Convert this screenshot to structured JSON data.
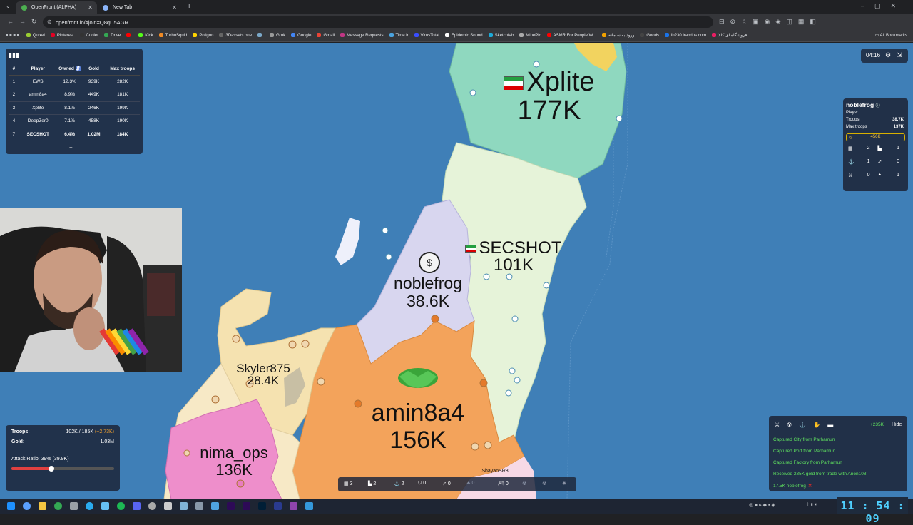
{
  "browser": {
    "tabs": [
      {
        "title": "OpenFront (ALPHA)",
        "active": true
      },
      {
        "title": "New Tab",
        "active": false
      }
    ],
    "url": "openfront.io/#join=Q8qU5AGR",
    "bookmarks": [
      {
        "label": "Quixel",
        "color": "#9acd32"
      },
      {
        "label": "Pinterest",
        "color": "#e60023"
      },
      {
        "label": "Cooler",
        "color": "#333333"
      },
      {
        "label": "Drive",
        "color": "#34a853"
      },
      {
        "label": "",
        "color": "#ff0000"
      },
      {
        "label": "Kick",
        "color": "#53fc18"
      },
      {
        "label": "TurboSquid",
        "color": "#f08a24"
      },
      {
        "label": "Poligon",
        "color": "#ffd400"
      },
      {
        "label": "3Dassets.one",
        "color": "#666666"
      },
      {
        "label": "",
        "color": "#7aa7c7"
      },
      {
        "label": "Grok",
        "color": "#999999"
      },
      {
        "label": "Google",
        "color": "#4285f4"
      },
      {
        "label": "Gmail",
        "color": "#ea4335"
      },
      {
        "label": "Message Requests",
        "color": "#c13584"
      },
      {
        "label": "Time.ir",
        "color": "#4aa3df"
      },
      {
        "label": "VirusTotal",
        "color": "#394eff"
      },
      {
        "label": "Epidemic Sound",
        "color": "#ffffff"
      },
      {
        "label": "Sketchfab",
        "color": "#1caad9"
      },
      {
        "label": "MinePic",
        "color": "#aaaaaa"
      },
      {
        "label": "ASMR For People W...",
        "color": "#ff0000"
      },
      {
        "label": "ورود به سامانه",
        "color": "#f0a000"
      },
      {
        "label": "Goods",
        "color": "#444444"
      },
      {
        "label": "ih230.irandns.com",
        "color": "#1a73e8"
      },
      {
        "label": "فروشگاه ای کالا",
        "color": "#e91e63"
      }
    ],
    "all_bookmarks": "All Bookmarks"
  },
  "leaderboard": {
    "headers": [
      "#",
      "Player",
      "Owned",
      "Gold",
      "Max troops"
    ],
    "rows": [
      {
        "rank": "1",
        "player": "EWS",
        "owned": "12.3%",
        "gold": "939K",
        "max_troops": "282K"
      },
      {
        "rank": "2",
        "player": "amin8a4",
        "owned": "8.9%",
        "gold": "449K",
        "max_troops": "181K"
      },
      {
        "rank": "3",
        "player": "Xplite",
        "owned": "8.1%",
        "gold": "246K",
        "max_troops": "199K"
      },
      {
        "rank": "4",
        "player": "DeepZer0",
        "owned": "7.1%",
        "gold": "458K",
        "max_troops": "190K"
      },
      {
        "rank": "7",
        "player": "SECSHOT",
        "owned": "6.4%",
        "gold": "1.02M",
        "max_troops": "184K"
      }
    ],
    "more": "+"
  },
  "timer": "04:16",
  "player_panel": {
    "name": "noblefrog",
    "type": "Player",
    "troops_label": "Troops",
    "troops": "38.7K",
    "max_troops_label": "Max troops",
    "max_troops": "137K",
    "gold": "456K",
    "buildings": [
      {
        "icon": "city-icon",
        "glyph": "▦",
        "count": "2"
      },
      {
        "icon": "factory-icon",
        "glyph": "▙",
        "count": "1"
      },
      {
        "icon": "port-icon",
        "glyph": "⚓",
        "count": "1"
      },
      {
        "icon": "missile-silo-icon",
        "glyph": "➶",
        "count": "0"
      },
      {
        "icon": "defense-post-icon",
        "glyph": "⚔",
        "count": "0"
      },
      {
        "icon": "sam-launcher-icon",
        "glyph": "⏶",
        "count": "1"
      }
    ]
  },
  "map_labels": [
    {
      "name": "Xplite",
      "troops": "177K",
      "flag": "iran"
    },
    {
      "name": "SECSHOT",
      "troops": "101K",
      "flag": "iran"
    },
    {
      "name": "noblefrog",
      "troops": "38.6K",
      "flag": ""
    },
    {
      "name": "Skyler875",
      "troops": "28.4K",
      "flag": ""
    },
    {
      "name": "amin8a4",
      "troops": "156K",
      "flag": ""
    },
    {
      "name": "nima_ops",
      "troops": "136K",
      "flag": ""
    },
    {
      "name": "ShayanSR8",
      "troops": "",
      "flag": ""
    }
  ],
  "troops_panel": {
    "troops_label": "Troops:",
    "troops_value": "102K / 185K",
    "troops_gain": "(+2.73K)",
    "gold_label": "Gold:",
    "gold_value": "1.03M",
    "attack_ratio_text": "Attack Ratio: 39% (39.9K)",
    "attack_ratio": 0.39
  },
  "action_bar": [
    {
      "icon": "city-icon",
      "glyph": "▦",
      "count": "3",
      "dim": false
    },
    {
      "icon": "factory-icon",
      "glyph": "▙",
      "count": "2",
      "dim": false
    },
    {
      "icon": "port-icon",
      "glyph": "⚓",
      "count": "2",
      "dim": false
    },
    {
      "icon": "defense-icon",
      "glyph": "⛉",
      "count": "0",
      "dim": false
    },
    {
      "icon": "missile-silo-icon",
      "glyph": "➶",
      "count": "0",
      "dim": false
    },
    {
      "icon": "sam-icon",
      "glyph": "⏶",
      "count": "0",
      "dim": true
    },
    {
      "icon": "warship-icon",
      "glyph": "⛴",
      "count": "0",
      "dim": false
    },
    {
      "icon": "atom-bomb-icon",
      "glyph": "☢",
      "count": "",
      "dim": true
    },
    {
      "icon": "hydrogen-bomb-icon",
      "glyph": "☢",
      "count": "",
      "dim": true
    },
    {
      "icon": "mirv-icon",
      "glyph": "✸",
      "count": "",
      "dim": true
    }
  ],
  "event_log": {
    "gain": "+235K",
    "hide": "Hide",
    "messages": [
      "Captured City from Parhamun",
      "Captured Port from Parhamun",
      "Captured Factory from Parhamun",
      "Received 235K gold from trade with Anon108",
      "17.5K noblefrog"
    ]
  },
  "clock": "11 : 54 : 09",
  "colors": {
    "ocean": "#3f7fb7",
    "panel": "#1e283c",
    "event_text": "#5fe05f"
  }
}
